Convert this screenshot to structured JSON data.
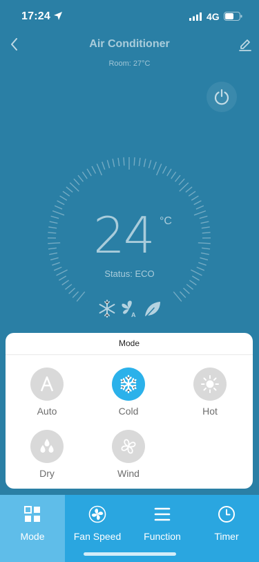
{
  "status_bar": {
    "time": "17:24",
    "network": "4G"
  },
  "header": {
    "title": "Air Conditioner",
    "room": "Room: 27°C"
  },
  "thermostat": {
    "temperature": "24",
    "unit": "°C",
    "status": "Status: ECO"
  },
  "mode_sheet": {
    "title": "Mode",
    "selected": "Cold",
    "items": [
      {
        "label": "Auto",
        "icon": "auto-icon",
        "active": false
      },
      {
        "label": "Cold",
        "icon": "snowflake-icon",
        "active": true
      },
      {
        "label": "Hot",
        "icon": "sun-icon",
        "active": false
      },
      {
        "label": "Dry",
        "icon": "droplets-icon",
        "active": false
      },
      {
        "label": "Wind",
        "icon": "fan-icon",
        "active": false
      }
    ]
  },
  "bottom_nav": {
    "items": [
      {
        "label": "Mode",
        "icon": "mode-grid-icon",
        "active": true
      },
      {
        "label": "Fan Speed",
        "icon": "fan-icon",
        "active": false
      },
      {
        "label": "Function",
        "icon": "menu-icon",
        "active": false
      },
      {
        "label": "Timer",
        "icon": "clock-icon",
        "active": false
      }
    ]
  },
  "colors": {
    "background": "#2a7fa5",
    "accent": "#2bb1ea",
    "nav_bar": "#2aa6e0",
    "nav_active": "#5fbde9"
  }
}
